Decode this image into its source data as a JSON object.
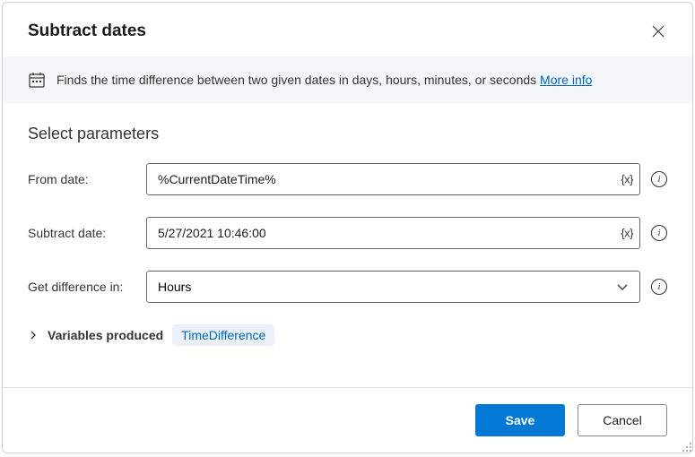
{
  "dialog": {
    "title": "Subtract dates"
  },
  "banner": {
    "text": "Finds the time difference between two given dates in days, hours, minutes, or seconds ",
    "linkText": "More info"
  },
  "section": {
    "title": "Select parameters"
  },
  "fields": {
    "fromDate": {
      "label": "From date:",
      "value": "%CurrentDateTime%"
    },
    "subtractDate": {
      "label": "Subtract date:",
      "value": "5/27/2021 10:46:00"
    },
    "getDifference": {
      "label": "Get difference in:",
      "value": "Hours"
    }
  },
  "variables": {
    "label": "Variables produced",
    "chip": "TimeDifference"
  },
  "footer": {
    "save": "Save",
    "cancel": "Cancel"
  }
}
